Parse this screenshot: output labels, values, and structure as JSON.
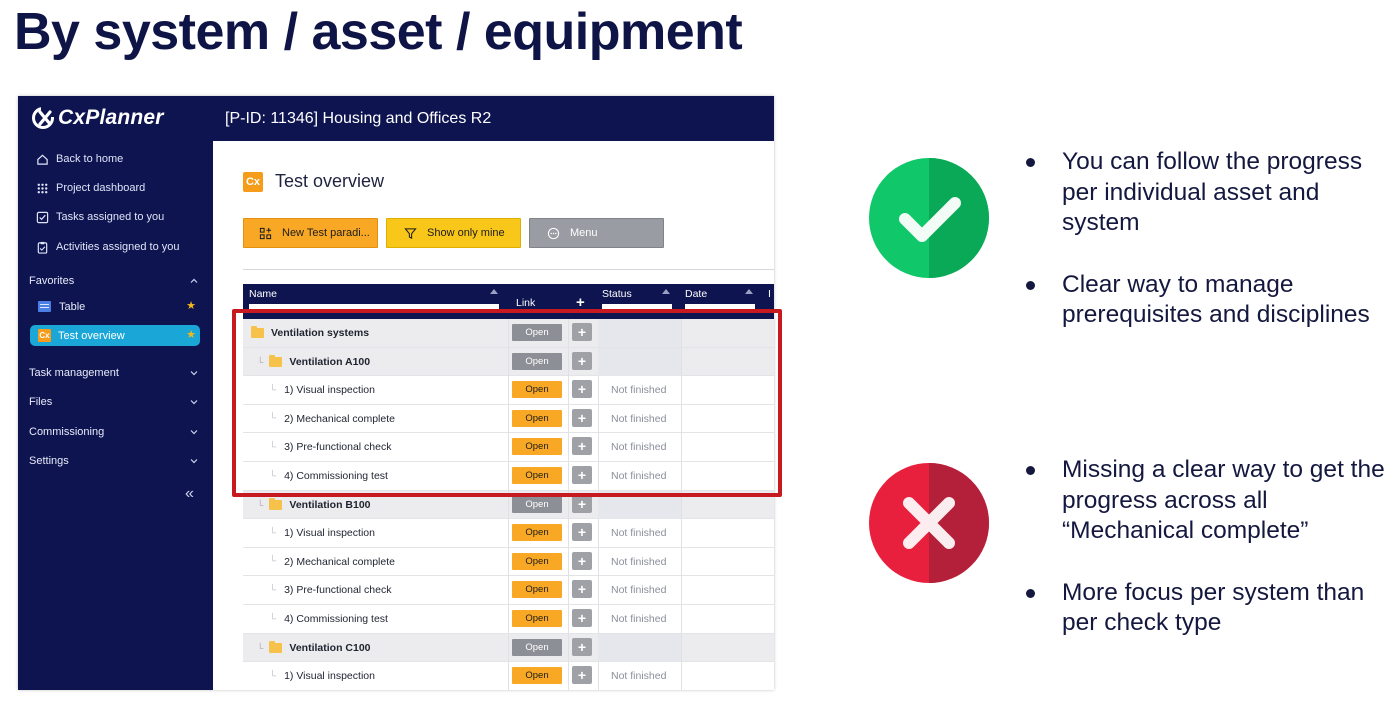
{
  "slide": {
    "title": "By system / asset / equipment"
  },
  "app": {
    "brand": "CxPlanner",
    "project_title": "[P-ID: 11346] Housing and Offices R2",
    "nav": [
      {
        "label": "Back to home",
        "icon": "home-icon"
      },
      {
        "label": "Project dashboard",
        "icon": "grid-icon"
      },
      {
        "label": "Tasks assigned to you",
        "icon": "checkbox-icon"
      },
      {
        "label": "Activities assigned to you",
        "icon": "clipboard-icon"
      }
    ],
    "favorites": {
      "label": "Favorites",
      "items": [
        {
          "label": "Table",
          "icon": "table-icon",
          "starred": true
        },
        {
          "label": "Test overview",
          "icon": "cx-icon",
          "starred": true,
          "active": true
        }
      ]
    },
    "sections": [
      "Task management",
      "Files",
      "Commissioning",
      "Settings"
    ],
    "page": {
      "icon_text": "Cx",
      "title": "Test overview",
      "buttons": {
        "new": "New Test paradi...",
        "mine": "Show only mine",
        "menu": "Menu"
      },
      "columns": {
        "name": "Name",
        "link": "Link",
        "status": "Status",
        "date": "Date"
      },
      "rows": [
        {
          "name": "Ventilation systems",
          "level": 0,
          "group": true,
          "open": "Open",
          "status": ""
        },
        {
          "name": "Ventilation A100",
          "level": 1,
          "group": true,
          "open": "Open",
          "status": ""
        },
        {
          "name": "1) Visual inspection",
          "level": 2,
          "group": false,
          "open": "Open",
          "status": "Not finished"
        },
        {
          "name": "2) Mechanical complete",
          "level": 2,
          "group": false,
          "open": "Open",
          "status": "Not finished"
        },
        {
          "name": "3) Pre-functional check",
          "level": 2,
          "group": false,
          "open": "Open",
          "status": "Not finished"
        },
        {
          "name": "4) Commissioning test",
          "level": 2,
          "group": false,
          "open": "Open",
          "status": "Not finished"
        },
        {
          "name": "Ventilation B100",
          "level": 1,
          "group": true,
          "open": "Open",
          "status": ""
        },
        {
          "name": "1) Visual inspection",
          "level": 2,
          "group": false,
          "open": "Open",
          "status": "Not finished"
        },
        {
          "name": "2) Mechanical complete",
          "level": 2,
          "group": false,
          "open": "Open",
          "status": "Not finished"
        },
        {
          "name": "3) Pre-functional check",
          "level": 2,
          "group": false,
          "open": "Open",
          "status": "Not finished"
        },
        {
          "name": "4) Commissioning test",
          "level": 2,
          "group": false,
          "open": "Open",
          "status": "Not finished"
        },
        {
          "name": "Ventilation C100",
          "level": 1,
          "group": true,
          "open": "Open",
          "status": ""
        },
        {
          "name": "1) Visual inspection",
          "level": 2,
          "group": false,
          "open": "Open",
          "status": "Not finished"
        }
      ]
    }
  },
  "pros": {
    "icon": "check-icon",
    "color": "#0fbf65",
    "items": [
      "You can follow the progress per individual asset and system",
      "Clear way to manage prerequisites and disciplines"
    ]
  },
  "cons": {
    "icon": "cross-icon",
    "color": "#e0233f",
    "items": [
      "Missing a clear way to get the progress across all “Mechanical complete”",
      "More focus per system than per check type"
    ]
  },
  "colors": {
    "navy": "#0d1450",
    "accent_orange": "#f9a825",
    "highlight_red": "#c71920"
  }
}
